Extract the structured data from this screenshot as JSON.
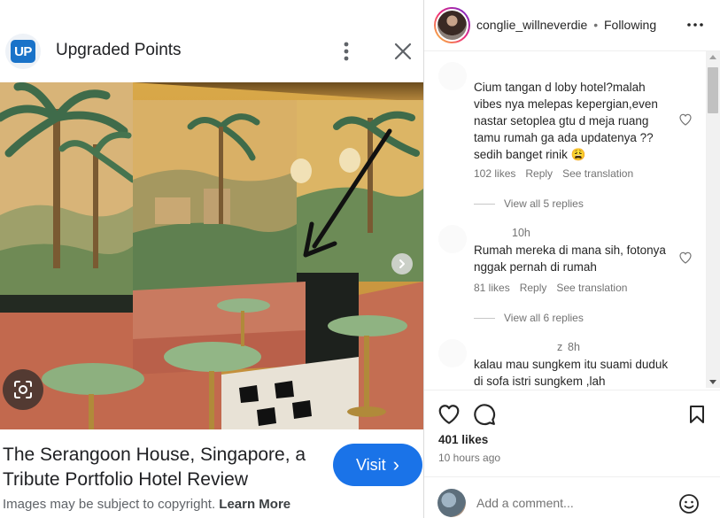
{
  "left": {
    "source_logo_text": "UP",
    "source_title": "Upgraded Points",
    "result_title": "The Serangoon House, Singapore, a Tribute Portfolio Hotel Review",
    "visit_label": "Visit",
    "visit_chevron": "›",
    "copyright_text": "Images may be subject to copyright.",
    "learn_more_label": "Learn More"
  },
  "post": {
    "username": "conglie_willneverdie",
    "separator": "•",
    "follow_status": "Following",
    "likes": "401 likes",
    "posted_ago": "10 hours ago",
    "comment_placeholder": "Add a comment..."
  },
  "comments": [
    {
      "text": "Cium tangan d loby hotel?malah vibes nya melepas kepergian,even nastar setoplea gtu d meja ruang tamu rumah ga ada updatenya ?? sedih banget rinik 😩",
      "likes": "102 likes",
      "reply": "Reply",
      "translate": "See translation",
      "view_replies": "View all 5 replies"
    },
    {
      "time": "10h",
      "text": "Rumah mereka di mana sih, fotonya nggak pernah di rumah",
      "likes": "81 likes",
      "reply": "Reply",
      "translate": "See translation",
      "view_replies": "View all 6 replies"
    },
    {
      "user_partial": "z",
      "time": "8h",
      "text": "kalau mau sungkem itu suami duduk di sofa istri sungkem ,lah"
    }
  ],
  "colors": {
    "visit_button": "#1a73e8",
    "logo_blue": "#1a73c9",
    "muted_text": "#737373"
  }
}
